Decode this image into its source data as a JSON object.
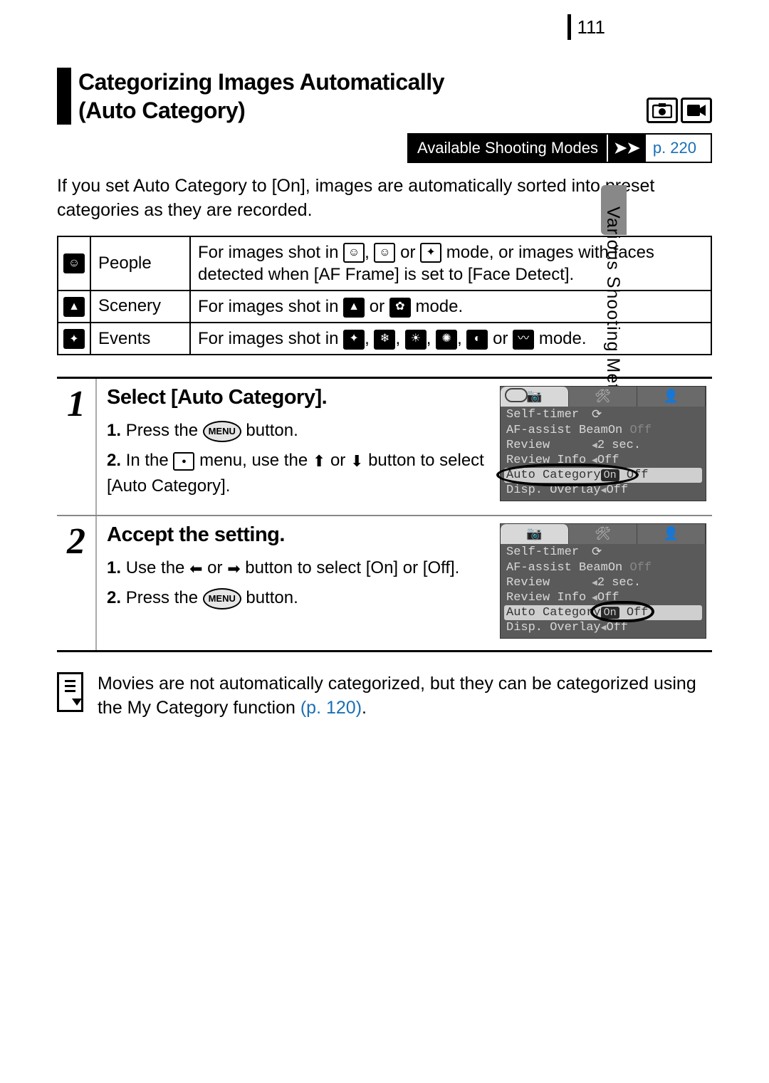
{
  "page_number": "111",
  "side_label": "Various Shooting Methods",
  "heading_line1": "Categorizing Images Automatically",
  "heading_line2": "(Auto Category)",
  "asm_label": "Available Shooting Modes",
  "asm_link": "p. 220",
  "intro": "If you set Auto Category to [On], images are automatically sorted into preset categories as they are recorded.",
  "categories": [
    {
      "name": "People",
      "desc_pre": "For images shot in ",
      "desc_post": " mode, or images with faces detected when [AF Frame] is set to [Face Detect]."
    },
    {
      "name": "Scenery",
      "desc_pre": "For images shot in ",
      "desc_post": " mode."
    },
    {
      "name": "Events",
      "desc_pre": "For images shot in ",
      "desc_post": " mode."
    }
  ],
  "steps": [
    {
      "num": "1",
      "title": "Select [Auto Category].",
      "sub1_a": "Press the ",
      "sub1_b": " button.",
      "sub2_a": "In the ",
      "sub2_b": " menu, use the ",
      "sub2_c": " or ",
      "sub2_d": " button to select [Auto Category].",
      "menu_btn": "MENU"
    },
    {
      "num": "2",
      "title": "Accept the setting.",
      "sub1_a": "Use the ",
      "sub1_b": " or ",
      "sub1_c": " button to select [On] or [Off].",
      "sub2_a": "Press the ",
      "sub2_b": " button.",
      "menu_btn": "MENU"
    }
  ],
  "lcd": {
    "tabs_cam": "📷",
    "rows": [
      {
        "k": "Self-timer",
        "v": "⟳"
      },
      {
        "k": "AF-assist Beam",
        "on": "On",
        "off": "Off"
      },
      {
        "k": "Review",
        "v": "2 sec."
      },
      {
        "k": "Review Info",
        "v": "Off"
      },
      {
        "k": "Auto Category",
        "on": "On",
        "off": "Off"
      },
      {
        "k": "Disp. Overlay",
        "v": "Off"
      }
    ]
  },
  "note_a": "Movies are not automatically categorized, but they can be categorized using the My Category function ",
  "note_link": "(p. 120)",
  "note_b": ".",
  "joiner_comma": ", ",
  "joiner_or": " or "
}
